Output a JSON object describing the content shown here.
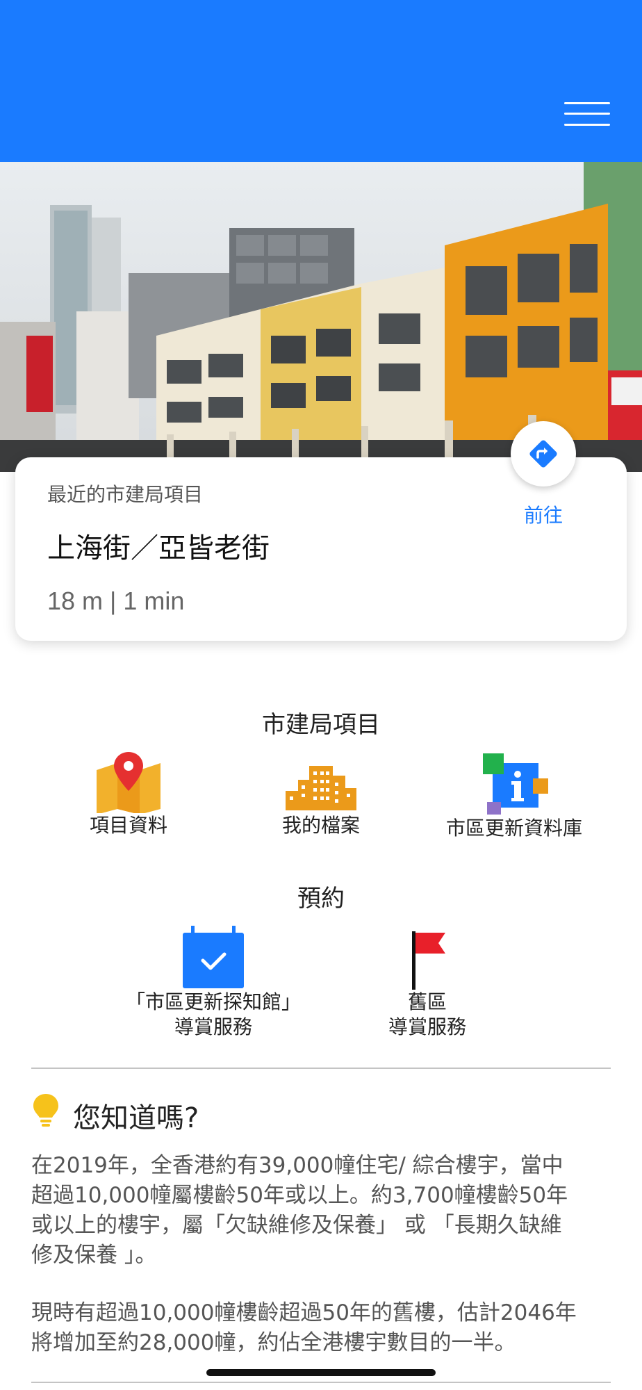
{
  "header": {
    "menu_icon": "hamburger-menu-icon",
    "color": "#1a7bff"
  },
  "hero": {
    "image": "building-photo"
  },
  "nearest": {
    "subtitle": "最近的市建局項目",
    "title": "上海街／亞皆老街",
    "meta": "18 m | 1 min",
    "go_label": "前往",
    "go_icon": "directions-icon"
  },
  "projects": {
    "title": "市建局項目",
    "items": [
      {
        "label": "項目資料",
        "icon": "map-pin-icon"
      },
      {
        "label": "我的檔案",
        "icon": "buildings-icon"
      },
      {
        "label": "市區更新資料庫",
        "icon": "info-database-icon"
      }
    ]
  },
  "booking": {
    "title": "預約",
    "items": [
      {
        "line1": "「市區更新探知館」",
        "line2": "導賞服務",
        "icon": "calendar-check-icon"
      },
      {
        "line1": "舊區",
        "line2": "導賞服務",
        "icon": "flag-icon"
      }
    ]
  },
  "tip": {
    "icon": "lightbulb-icon",
    "title": "您知道嗎?",
    "lines1": [
      "在2019年，全香港約有39,000幢住宅/ 綜合樓宇，當中",
      "超過10,000幢屬樓齡50年或以上。約3,700幢樓齡50年",
      "或以上的樓宇，屬「欠缺維修及保養」 或 「長期久缺維",
      "修及保養 」。"
    ],
    "lines2": [
      "現時有超過10,000幢樓齡超過50年的舊樓，估計2046年",
      "將增加至約28,000幢，約佔全港樓宇數目的一半。"
    ]
  }
}
